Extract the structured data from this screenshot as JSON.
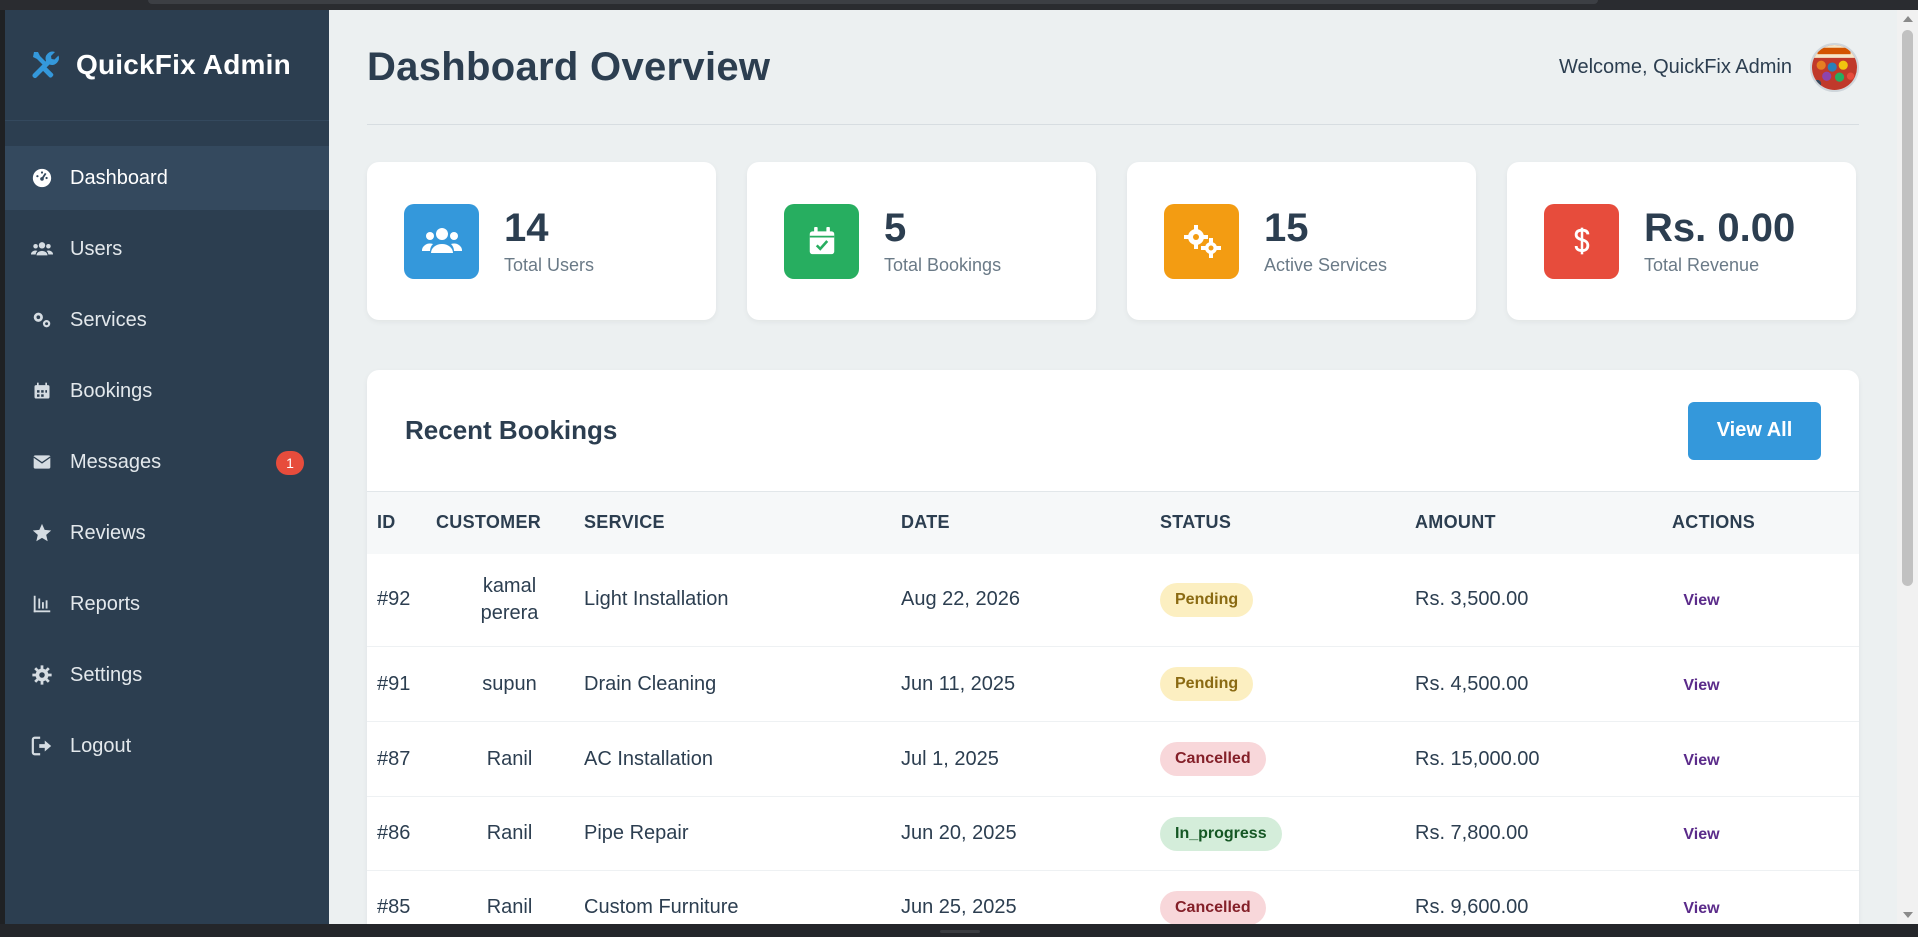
{
  "brand": {
    "name": "QuickFix Admin"
  },
  "sidebar": {
    "items": [
      {
        "label": "Dashboard",
        "icon": "gauge-icon",
        "active": true
      },
      {
        "label": "Users",
        "icon": "users-icon"
      },
      {
        "label": "Services",
        "icon": "cogs-icon"
      },
      {
        "label": "Bookings",
        "icon": "calendar-icon"
      },
      {
        "label": "Messages",
        "icon": "envelope-icon",
        "badge": "1"
      },
      {
        "label": "Reviews",
        "icon": "star-icon"
      },
      {
        "label": "Reports",
        "icon": "chart-icon"
      },
      {
        "label": "Settings",
        "icon": "gear-icon"
      },
      {
        "label": "Logout",
        "icon": "logout-icon"
      }
    ]
  },
  "header": {
    "title": "Dashboard Overview",
    "welcome": "Welcome, QuickFix Admin"
  },
  "stats": [
    {
      "value": "14",
      "label": "Total Users",
      "color": "#3498db",
      "icon": "users-icon"
    },
    {
      "value": "5",
      "label": "Total Bookings",
      "color": "#27ae60",
      "icon": "calendar-check-icon"
    },
    {
      "value": "15",
      "label": "Active Services",
      "color": "#f39c12",
      "icon": "cogs-icon"
    },
    {
      "value": "Rs. 0.00",
      "label": "Total Revenue",
      "color": "#e74c3c",
      "icon": "dollar-icon"
    }
  ],
  "recent_bookings": {
    "title": "Recent Bookings",
    "view_all_label": "View All",
    "columns": [
      "ID",
      "CUSTOMER",
      "SERVICE",
      "DATE",
      "STATUS",
      "AMOUNT",
      "ACTIONS"
    ],
    "rows": [
      {
        "id": "#92",
        "customer": "kamal perera",
        "service": "Light Installation",
        "date": "Aug 22, 2026",
        "status": "Pending",
        "amount": "Rs. 3,500.00",
        "action": "View"
      },
      {
        "id": "#91",
        "customer": "supun",
        "service": "Drain Cleaning",
        "date": "Jun 11, 2025",
        "status": "Pending",
        "amount": "Rs. 4,500.00",
        "action": "View"
      },
      {
        "id": "#87",
        "customer": "Ranil",
        "service": "AC Installation",
        "date": "Jul 1, 2025",
        "status": "Cancelled",
        "amount": "Rs. 15,000.00",
        "action": "View"
      },
      {
        "id": "#86",
        "customer": "Ranil",
        "service": "Pipe Repair",
        "date": "Jun 20, 2025",
        "status": "In_progress",
        "amount": "Rs. 7,800.00",
        "action": "View"
      },
      {
        "id": "#85",
        "customer": "Ranil",
        "service": "Custom Furniture",
        "date": "Jun 25, 2025",
        "status": "Cancelled",
        "amount": "Rs. 9,600.00",
        "action": "View"
      }
    ]
  },
  "colors": {
    "sidebar_bg": "#2c3e50",
    "sidebar_active": "#34495e",
    "accent": "#3498db",
    "badge": "#e74c3c",
    "page_bg": "#ecf0f1"
  }
}
